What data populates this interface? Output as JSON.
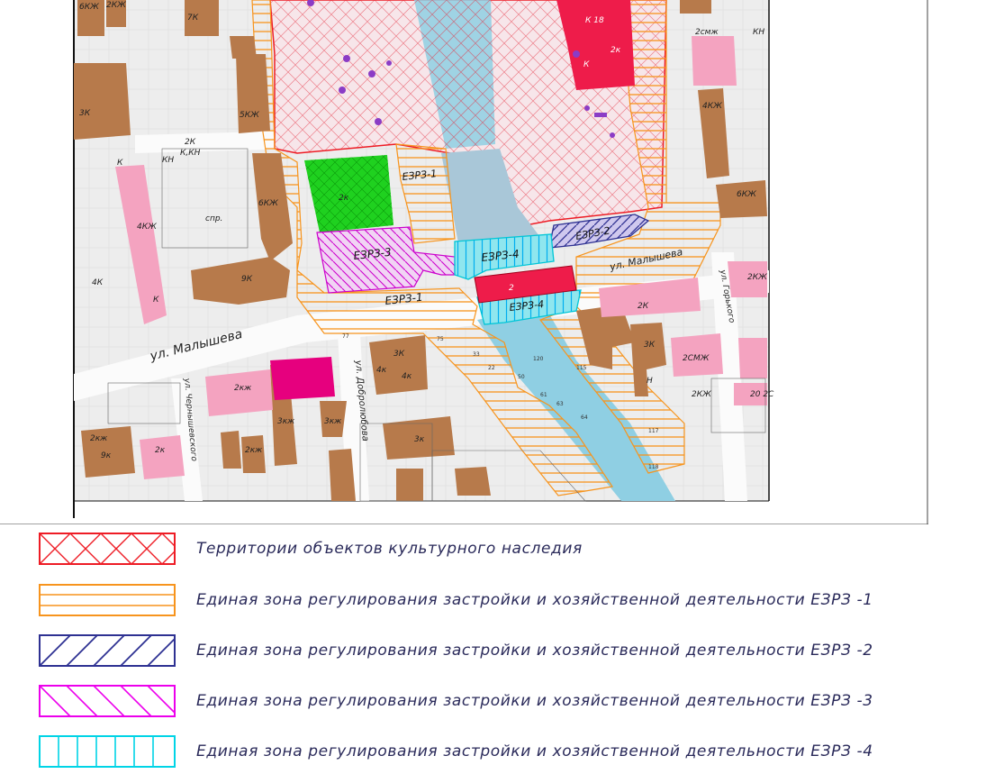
{
  "map": {
    "streets": {
      "malysheva_main": "ул. Малышева",
      "malysheva_upper": "ул. Малышева",
      "dobrolyubova": "ул. Добролюбова",
      "chernyshevskogo": "ул. Чернышевского",
      "gorkogo": "ул. Горького"
    },
    "zone_labels": {
      "ezrz1_top": "ЕЗРЗ-1",
      "ezrz1_mid": "ЕЗРЗ-1",
      "ezrz2": "ЕЗРЗ-2",
      "ezrz3": "ЕЗРЗ-3",
      "ezrz4_top": "ЕЗРЗ-4",
      "ezrz4_bottom": "ЕЗРЗ-4"
    },
    "building_labels": {
      "b_6kzh": "6КЖ",
      "b_2kzh_top": "2КЖ",
      "b_3k_left": "3К",
      "b_5kzh": "5КЖ",
      "b_2k_kn": "2К",
      "b_kkn": "К,КН",
      "b_kn": "КН",
      "b_4kzh_left": "4КЖ",
      "b_k": "К",
      "b_4k_left": "4К",
      "b_10k": "К",
      "b_spr": "спр.",
      "b_6kzh_mid": "6КЖ",
      "b_9k": "9К",
      "b_2k_green": "2к",
      "b_7k": "7К",
      "b_3k_mid": "3К",
      "b_4k_a": "4к",
      "b_4k_b": "4к",
      "b_2kzh_pink": "2кж",
      "b_3kzh_a": "3кж",
      "b_3kzh_b": "3кж",
      "b_2kzh_small": "2кж",
      "b_2k_small": "2к",
      "b_9k_small": "9к",
      "b_2kzh_bottom": "2кж",
      "b_3k_bottom": "3к",
      "b_2k_red": "2",
      "b_2k_right": "2К",
      "b_3k_right": "3К",
      "b_n": "Н",
      "b_2smzh": "2СМЖ",
      "b_2kzh_right": "2КЖ",
      "b_2kzh_far": "2КЖ",
      "b_6kzh_right": "6КЖ",
      "b_4kzh_right": "4КЖ",
      "b_2smzh_top": "2смж",
      "b_kn_top": "КН",
      "b_2k_redtop": "2к",
      "b_k_red": "К",
      "b_18k": "К 18",
      "b_2kzh_bot2": "2КЖ",
      "b_20_2s": "20 2С"
    },
    "colors": {
      "heritage": "#ee1c25",
      "ezrz1": "#f7941d",
      "ezrz2": "#2e3192",
      "ezrz3": "#ec00ec",
      "ezrz4": "#00aeef",
      "building_brown": "#b77a4b",
      "building_pink": "#f4a3c0",
      "building_red": "#ee1c4a",
      "building_magenta": "#e6007e",
      "green_area": "#1fd11f",
      "water": "#8fcfe3"
    }
  },
  "legend": {
    "items": [
      {
        "id": "heritage",
        "label": "Территории объектов культурного наследия",
        "color": "#ee1c25",
        "pattern": "crosshatch"
      },
      {
        "id": "ezrz1",
        "label": "Единая зона регулирования застройки и хозяйственной деятельности ЕЗРЗ -1",
        "color": "#f7941d",
        "pattern": "horizontal"
      },
      {
        "id": "ezrz2",
        "label": "Единая зона регулирования застройки и хозяйственной деятельности ЕЗРЗ -2",
        "color": "#2e3192",
        "pattern": "diagonal-forward"
      },
      {
        "id": "ezrz3",
        "label": "Единая зона регулирования застройки и хозяйственной деятельности ЕЗРЗ -3",
        "color": "#ec00ec",
        "pattern": "diagonal-backward"
      },
      {
        "id": "ezrz4",
        "label": "Единая зона регулирования застройки и хозяйственной деятельности ЕЗРЗ -4",
        "color": "#00d4e6",
        "pattern": "vertical"
      }
    ]
  }
}
